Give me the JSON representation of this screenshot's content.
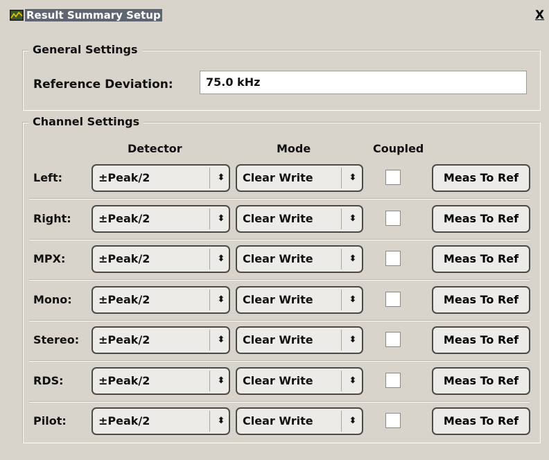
{
  "window": {
    "title": "Result Summary Setup",
    "close_label": "X"
  },
  "general": {
    "group_title": "General Settings",
    "ref_label": "Reference Deviation:",
    "ref_value": "75.0 kHz"
  },
  "channels": {
    "group_title": "Channel Settings",
    "headers": {
      "detector": "Detector",
      "mode": "Mode",
      "coupled": "Coupled"
    },
    "rows": [
      {
        "label": "Left:",
        "detector": "±Peak/2",
        "mode": "Clear Write",
        "coupled": false,
        "button": "Meas To Ref"
      },
      {
        "label": "Right:",
        "detector": "±Peak/2",
        "mode": "Clear Write",
        "coupled": false,
        "button": "Meas To Ref"
      },
      {
        "label": "MPX:",
        "detector": "±Peak/2",
        "mode": "Clear Write",
        "coupled": false,
        "button": "Meas To Ref"
      },
      {
        "label": "Mono:",
        "detector": "±Peak/2",
        "mode": "Clear Write",
        "coupled": false,
        "button": "Meas To Ref"
      },
      {
        "label": "Stereo:",
        "detector": "±Peak/2",
        "mode": "Clear Write",
        "coupled": false,
        "button": "Meas To Ref"
      },
      {
        "label": "RDS:",
        "detector": "±Peak/2",
        "mode": "Clear Write",
        "coupled": false,
        "button": "Meas To Ref"
      },
      {
        "label": "Pilot:",
        "detector": "±Peak/2",
        "mode": "Clear Write",
        "coupled": false,
        "button": "Meas To Ref"
      }
    ],
    "arrow_glyph": "⬍"
  }
}
